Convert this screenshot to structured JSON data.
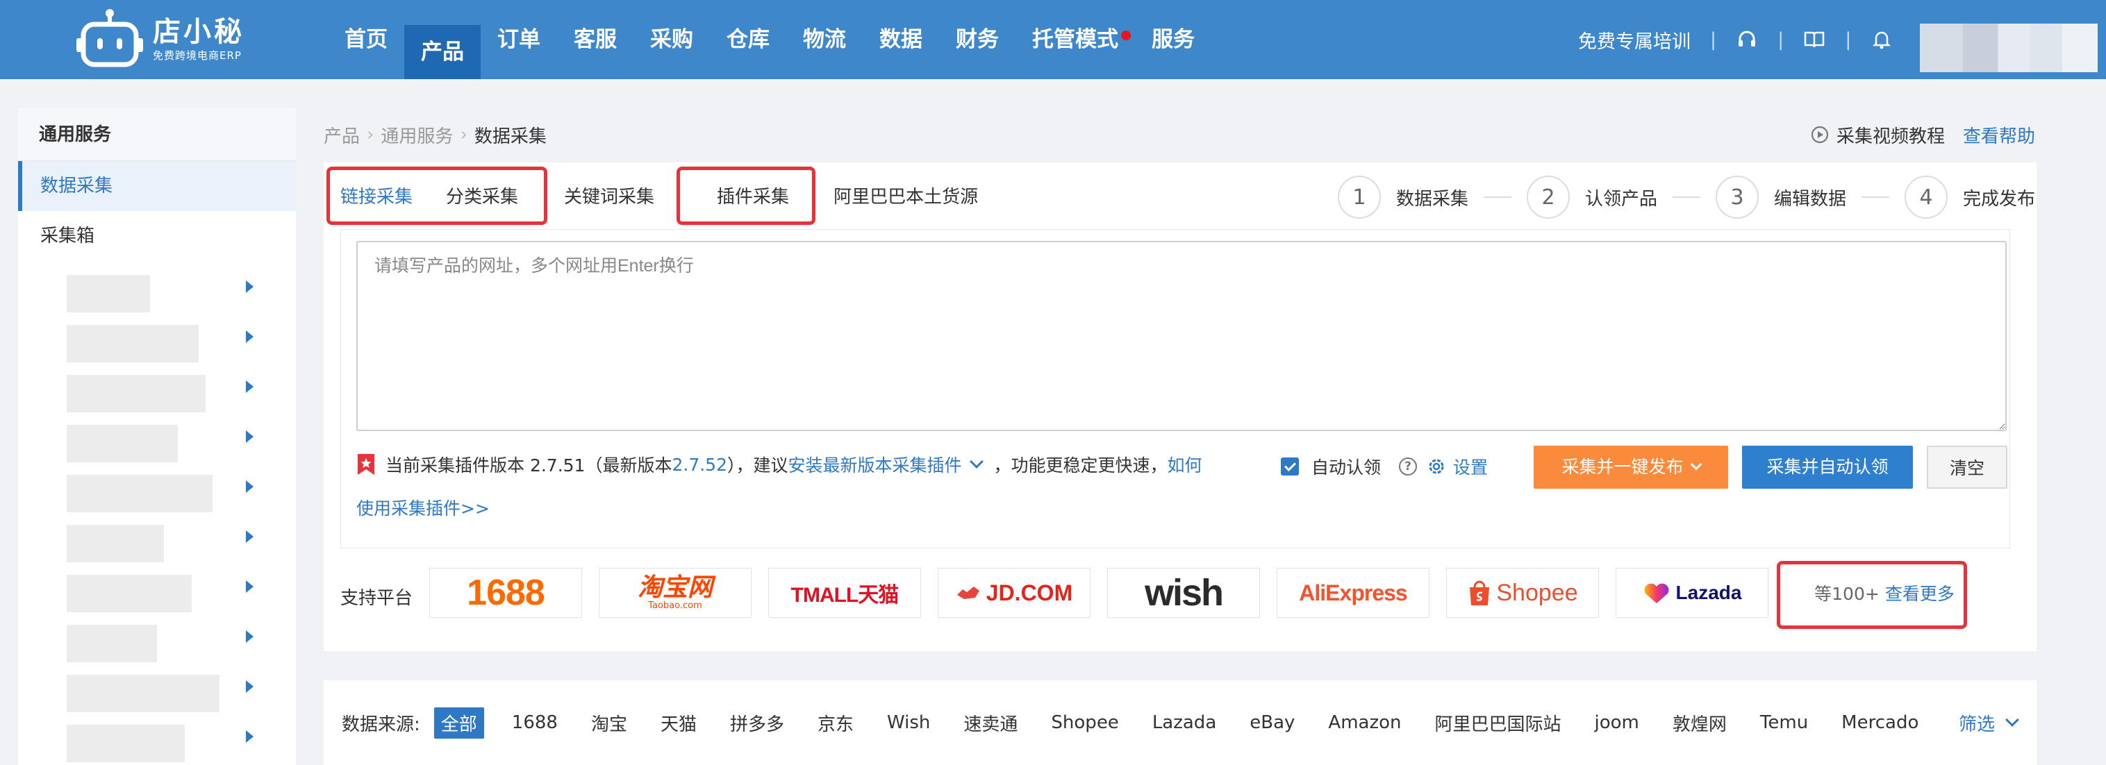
{
  "brand": {
    "name": "店小秘",
    "tagline": "免费跨境电商ERP"
  },
  "nav": {
    "items": [
      {
        "label": "首页"
      },
      {
        "label": "产品",
        "active": true
      },
      {
        "label": "订单"
      },
      {
        "label": "客服"
      },
      {
        "label": "采购"
      },
      {
        "label": "仓库"
      },
      {
        "label": "物流"
      },
      {
        "label": "数据"
      },
      {
        "label": "财务"
      },
      {
        "label": "托管模式",
        "badge": true
      },
      {
        "label": "服务"
      }
    ],
    "training_link": "免费专属培训",
    "icons": [
      "headset-icon",
      "book-icon",
      "bell-icon"
    ]
  },
  "sidebar": {
    "header": "通用服务",
    "items": [
      {
        "label": "数据采集",
        "active": true
      },
      {
        "label": "采集箱"
      }
    ]
  },
  "breadcrumb": [
    "产品",
    "通用服务",
    "数据采集"
  ],
  "help": {
    "video_tutorial": "采集视频教程",
    "help": "查看帮助"
  },
  "tabs": [
    {
      "label": "链接采集",
      "active": true
    },
    {
      "label": "分类采集"
    },
    {
      "label": "关键词采集"
    },
    {
      "label": "插件采集"
    },
    {
      "label": "阿里巴巴本土货源"
    }
  ],
  "steps": [
    {
      "num": "1",
      "label": "数据采集"
    },
    {
      "num": "2",
      "label": "认领产品"
    },
    {
      "num": "3",
      "label": "编辑数据"
    },
    {
      "num": "4",
      "label": "完成发布"
    }
  ],
  "url_input": {
    "placeholder": "请填写产品的网址，多个网址用Enter换行",
    "value": ""
  },
  "plugin_notice": {
    "prefix": "当前采集插件版本 2.7.51（最新版本 ",
    "latest": "2.7.52",
    "mid": "），建议 ",
    "install_link": "安装最新版本采集插件",
    "suffix": "，功能更稳定更快速，",
    "how_link": "如何",
    "how_link_2": "使用采集插件>>"
  },
  "auto_claim": {
    "label": "自动认领",
    "checked": true,
    "settings": "设置"
  },
  "buttons": {
    "collect_publish": "采集并一键发布",
    "collect_claim": "采集并自动认领",
    "clear": "清空"
  },
  "platforms": {
    "label": "支持平台",
    "logos": [
      {
        "text": "1688",
        "color": "#ff6a00"
      },
      {
        "text": "淘宝网",
        "sub": "Taobao.com",
        "color": "#ff4400"
      },
      {
        "text": "TMALL天猫",
        "color": "#e01122"
      },
      {
        "text": "JD.COM",
        "color": "#e1251b"
      },
      {
        "text": "wish",
        "color": "#2b2b2b"
      },
      {
        "text": "AliExpress",
        "color": "#f5522d"
      },
      {
        "text": "Shopee",
        "color": "#ee4d2d"
      },
      {
        "text": "Lazada",
        "color": "#0f136d"
      }
    ],
    "more_prefix": "等100+",
    "more_link": "查看更多"
  },
  "sources": {
    "label": "数据来源:",
    "items": [
      "全部",
      "1688",
      "淘宝",
      "天猫",
      "拼多多",
      "京东",
      "Wish",
      "速卖通",
      "Shopee",
      "Lazada",
      "eBay",
      "Amazon",
      "阿里巴巴国际站",
      "joom",
      "敦煌网",
      "Temu",
      "Mercado"
    ],
    "filter": "筛选"
  },
  "colors": {
    "primary": "#3f87cb",
    "accent": "#2f78c4",
    "orange": "#fa8a3c",
    "highlight": "#e8323a"
  }
}
